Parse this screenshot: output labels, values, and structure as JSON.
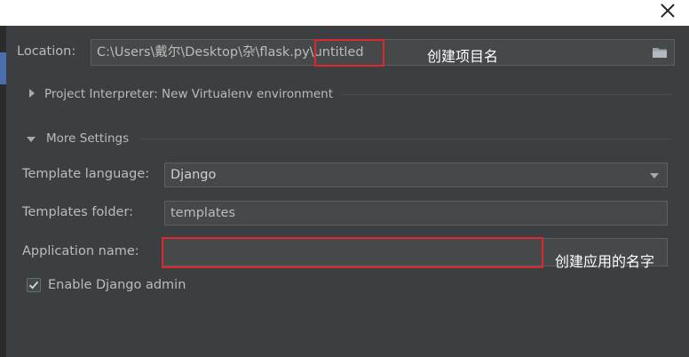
{
  "window": {
    "close_icon": "close-icon"
  },
  "location": {
    "label": "Location:",
    "value_prefix": "C:\\Users\\戴尔\\Desktop\\杂\\flask.py\\",
    "value_project": "untitled",
    "annotation": "创建项目名",
    "browse_icon": "folder-icon"
  },
  "interpreter": {
    "label": "Project Interpreter: New Virtualenv environment",
    "icon": "chevron-right-icon"
  },
  "more_settings": {
    "label": "More Settings",
    "icon": "chevron-down-icon",
    "template_language": {
      "label": "Template language:",
      "value": "Django"
    },
    "templates_folder": {
      "label": "Templates folder:",
      "value": "templates"
    },
    "application_name": {
      "label": "Application name:",
      "value": "",
      "annotation": "创建应用的名字"
    },
    "enable_admin": {
      "label": "Enable Django admin",
      "checked": true
    }
  },
  "colors": {
    "background": "#3c3f41",
    "field": "#45494a",
    "highlight": "#e0262d"
  }
}
